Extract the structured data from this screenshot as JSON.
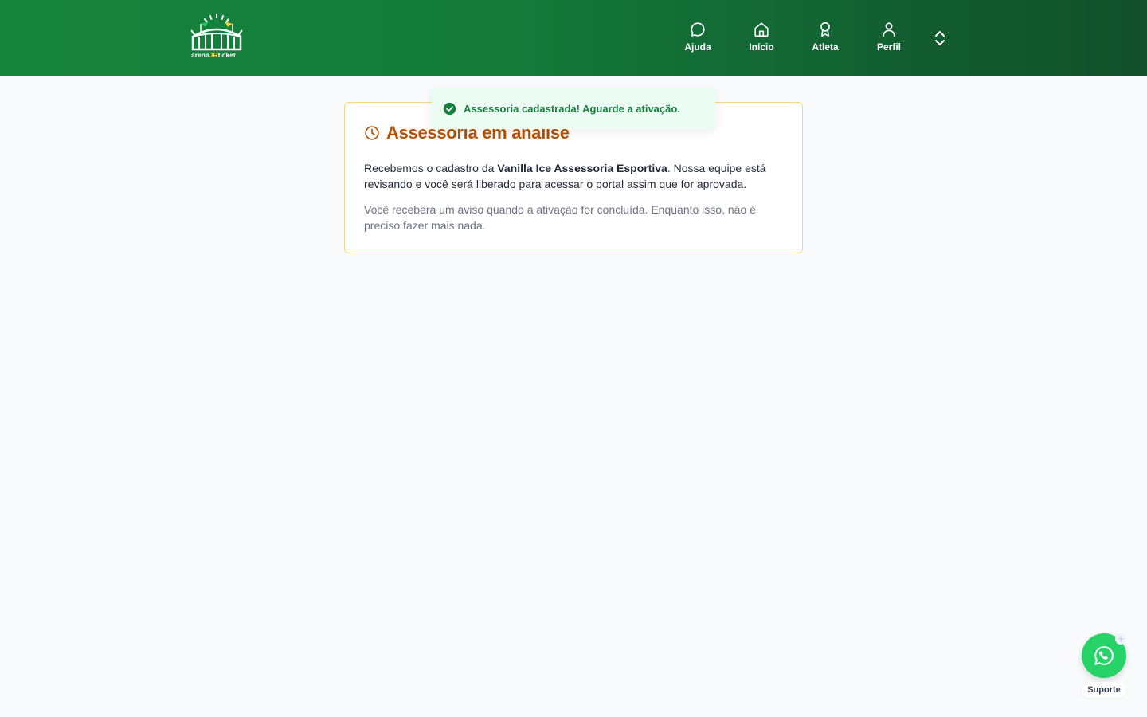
{
  "brand": {
    "logo_text_prefix": "arena",
    "logo_text_highlight": "JR",
    "logo_text_suffix": "ticket"
  },
  "nav": {
    "items": [
      {
        "label": "Ajuda",
        "icon": "chat-bubble-icon"
      },
      {
        "label": "Início",
        "icon": "home-icon"
      },
      {
        "label": "Atleta",
        "icon": "medal-icon"
      },
      {
        "label": "Perfil",
        "icon": "user-icon"
      }
    ],
    "expand_icon": "chevron-up-down-icon"
  },
  "toast": {
    "message": "Assessoria cadastrada! Aguarde a ativação.",
    "icon": "check-circle-icon"
  },
  "card": {
    "title": "Assessoria em análise",
    "icon": "clock-icon",
    "p1_before": "Recebemos o cadastro da ",
    "p1_bold": "Vanilla Ice Assessoria Esportiva",
    "p1_after": ". Nossa equipe está revisando e você será liberado para acessar o portal assim que for aprovada.",
    "p2": "Você receberá um aviso quando a ativação for concluída. Enquanto isso, não é preciso fazer mais nada."
  },
  "support": {
    "label": "Suporte",
    "icon": "whatsapp-icon"
  },
  "colors": {
    "header_start": "#16843d",
    "header_end": "#114f2a",
    "title_orange": "#b45309",
    "card_border": "#f6d77a",
    "toast_bg": "#ecfdf3",
    "toast_text": "#15803d",
    "whatsapp": "#25d366"
  }
}
